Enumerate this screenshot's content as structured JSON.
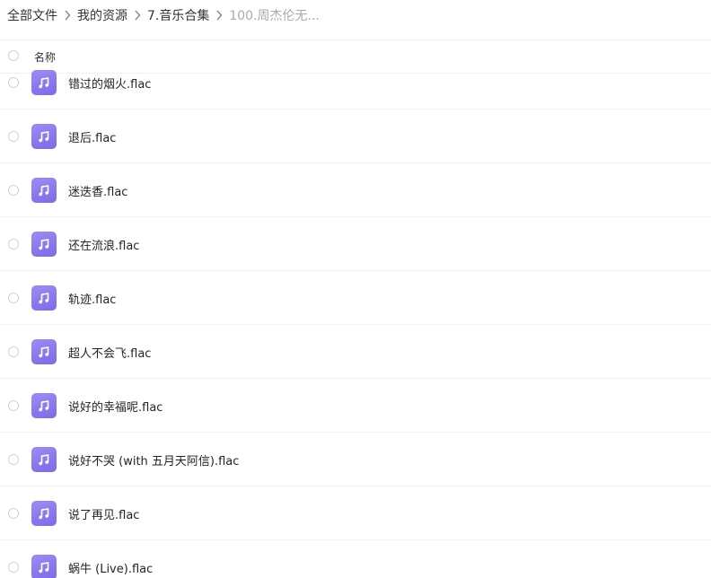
{
  "breadcrumb": [
    "全部文件",
    "我的资源",
    "7.音乐合集",
    "100.周杰伦无..."
  ],
  "header": {
    "name_label": "名称"
  },
  "files": [
    "错过的烟火.flac",
    "退后.flac",
    "迷迭香.flac",
    "还在流浪.flac",
    "轨迹.flac",
    "超人不会飞.flac",
    "说好的幸福呢.flac",
    "说好不哭 (with 五月天阿信).flac",
    "说了再见.flac",
    "蜗牛 (Live).flac"
  ],
  "icons": {
    "file": "music-note-icon",
    "separator": "chevron-right-icon"
  },
  "colors": {
    "icon_bg": "#8a7bef",
    "current_crumb": "#a8aab0"
  }
}
